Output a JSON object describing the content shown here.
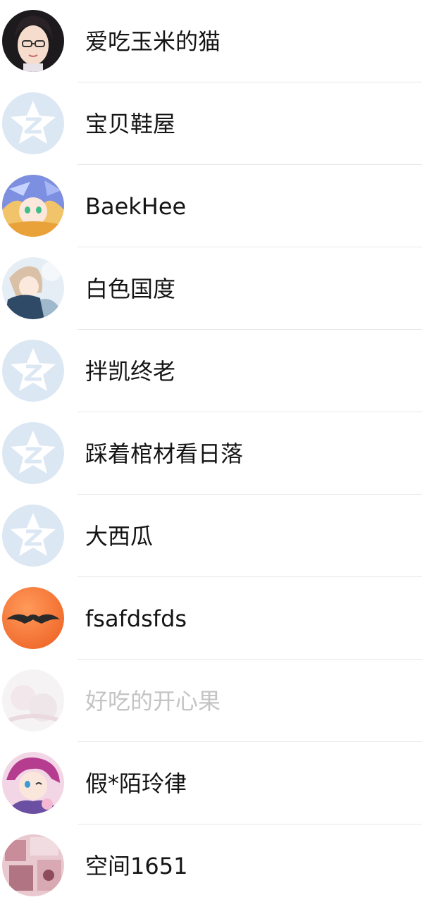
{
  "contacts": [
    {
      "name": "爱吃玉米的猫",
      "avatar": "avatar-girl-glasses"
    },
    {
      "name": "宝贝鞋屋",
      "avatar": "default-qzone-star-avatar"
    },
    {
      "name": "BaekHee",
      "avatar": "avatar-anime-blue-hair"
    },
    {
      "name": "白色国度",
      "avatar": "avatar-anime-winter-girl"
    },
    {
      "name": "拌凯终老",
      "avatar": "default-qzone-star-avatar"
    },
    {
      "name": "踩着棺材看日落",
      "avatar": "default-qzone-star-avatar"
    },
    {
      "name": "大西瓜",
      "avatar": "default-qzone-star-avatar"
    },
    {
      "name": "fsafdsfds",
      "avatar": "avatar-orange-mustache"
    },
    {
      "name": "好吃的开心果",
      "avatar": "avatar-faded-pink",
      "dimmed": true
    },
    {
      "name": "假*陌玲律",
      "avatar": "avatar-anime-pink-hair"
    },
    {
      "name": "空间1651",
      "avatar": "avatar-pink-collage"
    }
  ],
  "colors": {
    "default_avatar_bg": "#dce7f4",
    "default_avatar_star": "#ffffff",
    "text": "#141414",
    "dimmed_text": "#c4c4c4",
    "divider": "#e8e8e8"
  }
}
